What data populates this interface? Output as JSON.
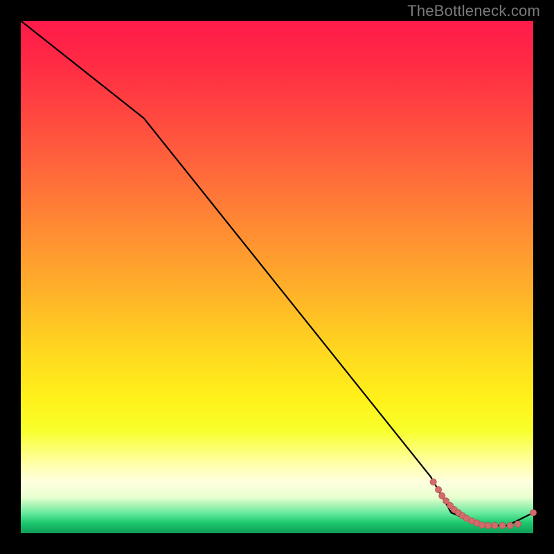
{
  "attribution": "TheBottleneck.com",
  "colors": {
    "line": "#000000",
    "marker_fill": "#d46a6a",
    "marker_stroke": "#b05656",
    "background": "#000000"
  },
  "chart_data": {
    "type": "line",
    "title": "",
    "xlabel": "",
    "ylabel": "",
    "xlim": [
      0,
      100
    ],
    "ylim": [
      0,
      100
    ],
    "grid": false,
    "legend": false,
    "notes": "x→ right, y→ up; curve descends from top-left to bottom-right, flattens into a valley near the bottom where scattered markers sit just above baseline.",
    "line_points": [
      {
        "x": 0,
        "y": 100
      },
      {
        "x": 24,
        "y": 81
      },
      {
        "x": 80,
        "y": 11
      },
      {
        "x": 84,
        "y": 4
      },
      {
        "x": 90,
        "y": 1.5
      },
      {
        "x": 95,
        "y": 1.5
      },
      {
        "x": 100,
        "y": 4
      }
    ],
    "markers": [
      {
        "x": 80.5,
        "y": 10.0
      },
      {
        "x": 81.5,
        "y": 8.5
      },
      {
        "x": 82.2,
        "y": 7.3
      },
      {
        "x": 83.0,
        "y": 6.3
      },
      {
        "x": 83.8,
        "y": 5.4
      },
      {
        "x": 84.6,
        "y": 4.6
      },
      {
        "x": 85.4,
        "y": 4.0
      },
      {
        "x": 86.2,
        "y": 3.4
      },
      {
        "x": 87.0,
        "y": 2.9
      },
      {
        "x": 88.0,
        "y": 2.4
      },
      {
        "x": 89.0,
        "y": 2.0
      },
      {
        "x": 90.0,
        "y": 1.6
      },
      {
        "x": 91.2,
        "y": 1.5
      },
      {
        "x": 92.5,
        "y": 1.5
      },
      {
        "x": 94.0,
        "y": 1.5
      },
      {
        "x": 95.5,
        "y": 1.5
      },
      {
        "x": 97.0,
        "y": 1.8
      },
      {
        "x": 100.0,
        "y": 4.0
      }
    ]
  }
}
